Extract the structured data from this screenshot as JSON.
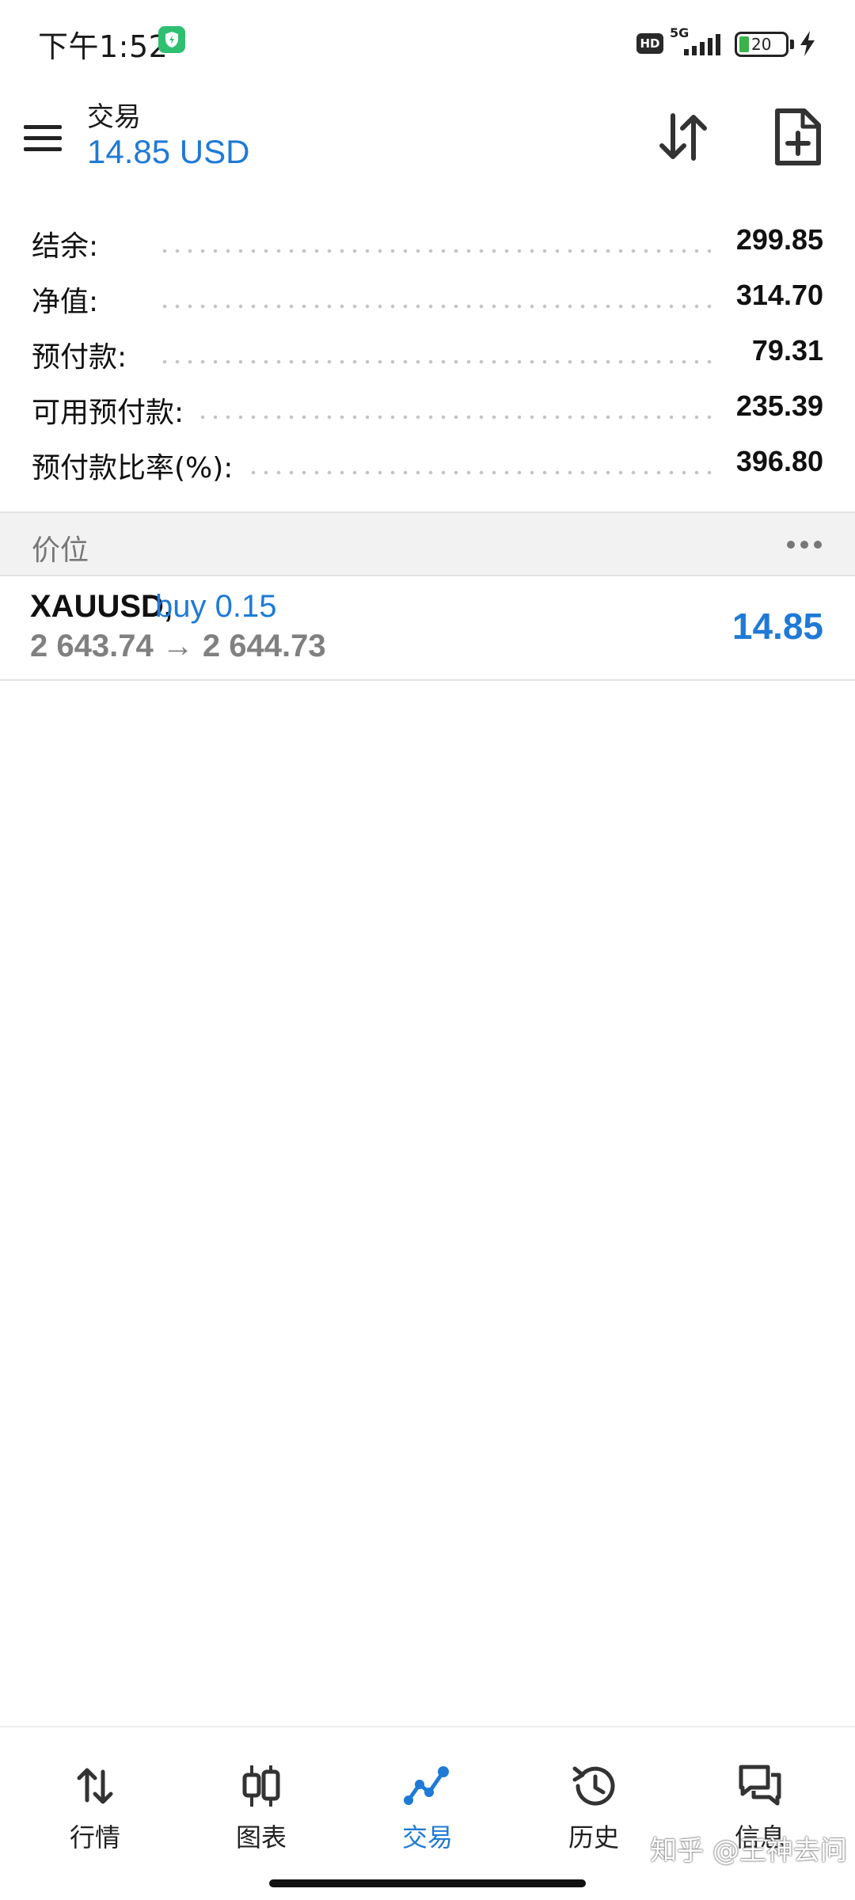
{
  "status_bar": {
    "time": "下午1:52",
    "hd": "HD",
    "network": "5G",
    "battery": "20"
  },
  "header": {
    "title": "交易",
    "subtitle": "14.85 USD"
  },
  "summary": [
    {
      "label": "结余:",
      "value": "299.85"
    },
    {
      "label": "净值:",
      "value": "314.70"
    },
    {
      "label": "预付款:",
      "value": "79.31"
    },
    {
      "label": "可用预付款:",
      "value": "235.39"
    },
    {
      "label": "预付款比率(%):",
      "value": "396.80"
    }
  ],
  "positions_section": {
    "title": "价位"
  },
  "positions": [
    {
      "symbol": "XAUUSD,",
      "type": "buy 0.15",
      "prices": "2 643.74 → 2 644.73",
      "profit": "14.85"
    }
  ],
  "nav": {
    "items": [
      {
        "label": "行情",
        "icon": "quotes-icon"
      },
      {
        "label": "图表",
        "icon": "charts-icon"
      },
      {
        "label": "交易",
        "icon": "trade-icon",
        "active": true
      },
      {
        "label": "历史",
        "icon": "history-icon"
      },
      {
        "label": "信息",
        "icon": "messages-icon"
      }
    ]
  },
  "watermark": "知乎 @王神去问",
  "colors": {
    "accent": "#1f7ad6",
    "muted": "#808080",
    "section_bg": "#f2f2f2"
  }
}
